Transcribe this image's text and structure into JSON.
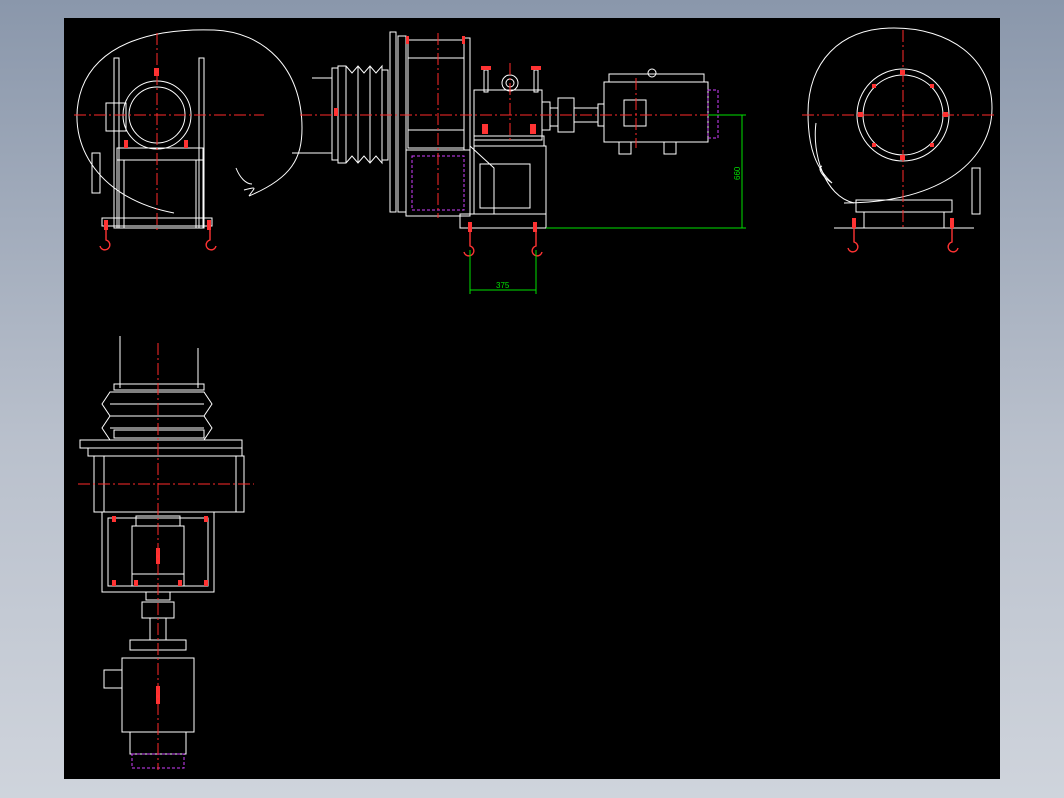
{
  "drawing": {
    "dimensions": {
      "height_label": "660",
      "width_label": "375"
    },
    "colors": {
      "background": "#000000",
      "outline": "#ffffff",
      "centerline": "#ff2a2a",
      "dimension": "#00e000",
      "hidden": "#d040ff"
    }
  }
}
